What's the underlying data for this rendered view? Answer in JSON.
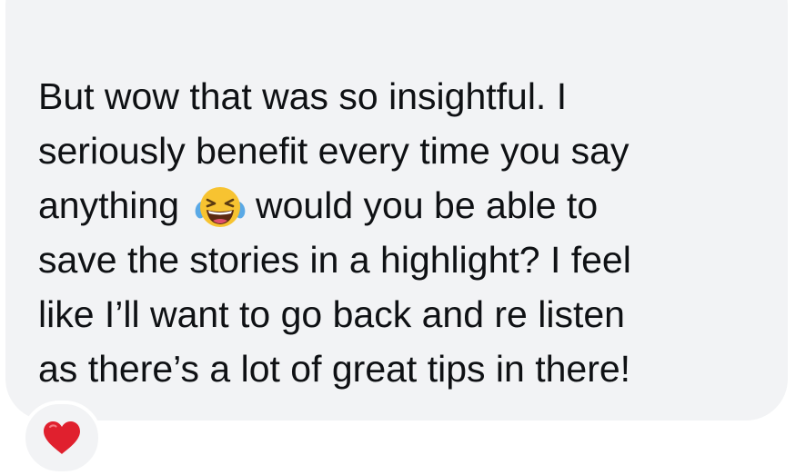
{
  "message": {
    "lines": {
      "l1": "But wow that was so insightful. I",
      "l2": "seriously benefit every time you say",
      "l3_before_emoji": "anything",
      "l3_after_emoji": "would you be able to",
      "l4": "save the stories in a highlight? I feel",
      "l5": "like I’ll want to go back and re listen",
      "l6": "as there’s a lot of great tips in there!"
    },
    "inline_emoji": "face-with-tears-of-joy-icon"
  },
  "reaction": {
    "emoji": "red-heart-icon"
  },
  "colors": {
    "bubble": "#f2f3f5",
    "text": "#0f1114",
    "heart": "#e0202e",
    "emoji_face": "#f7c331",
    "emoji_tears": "#5aa9e6"
  }
}
